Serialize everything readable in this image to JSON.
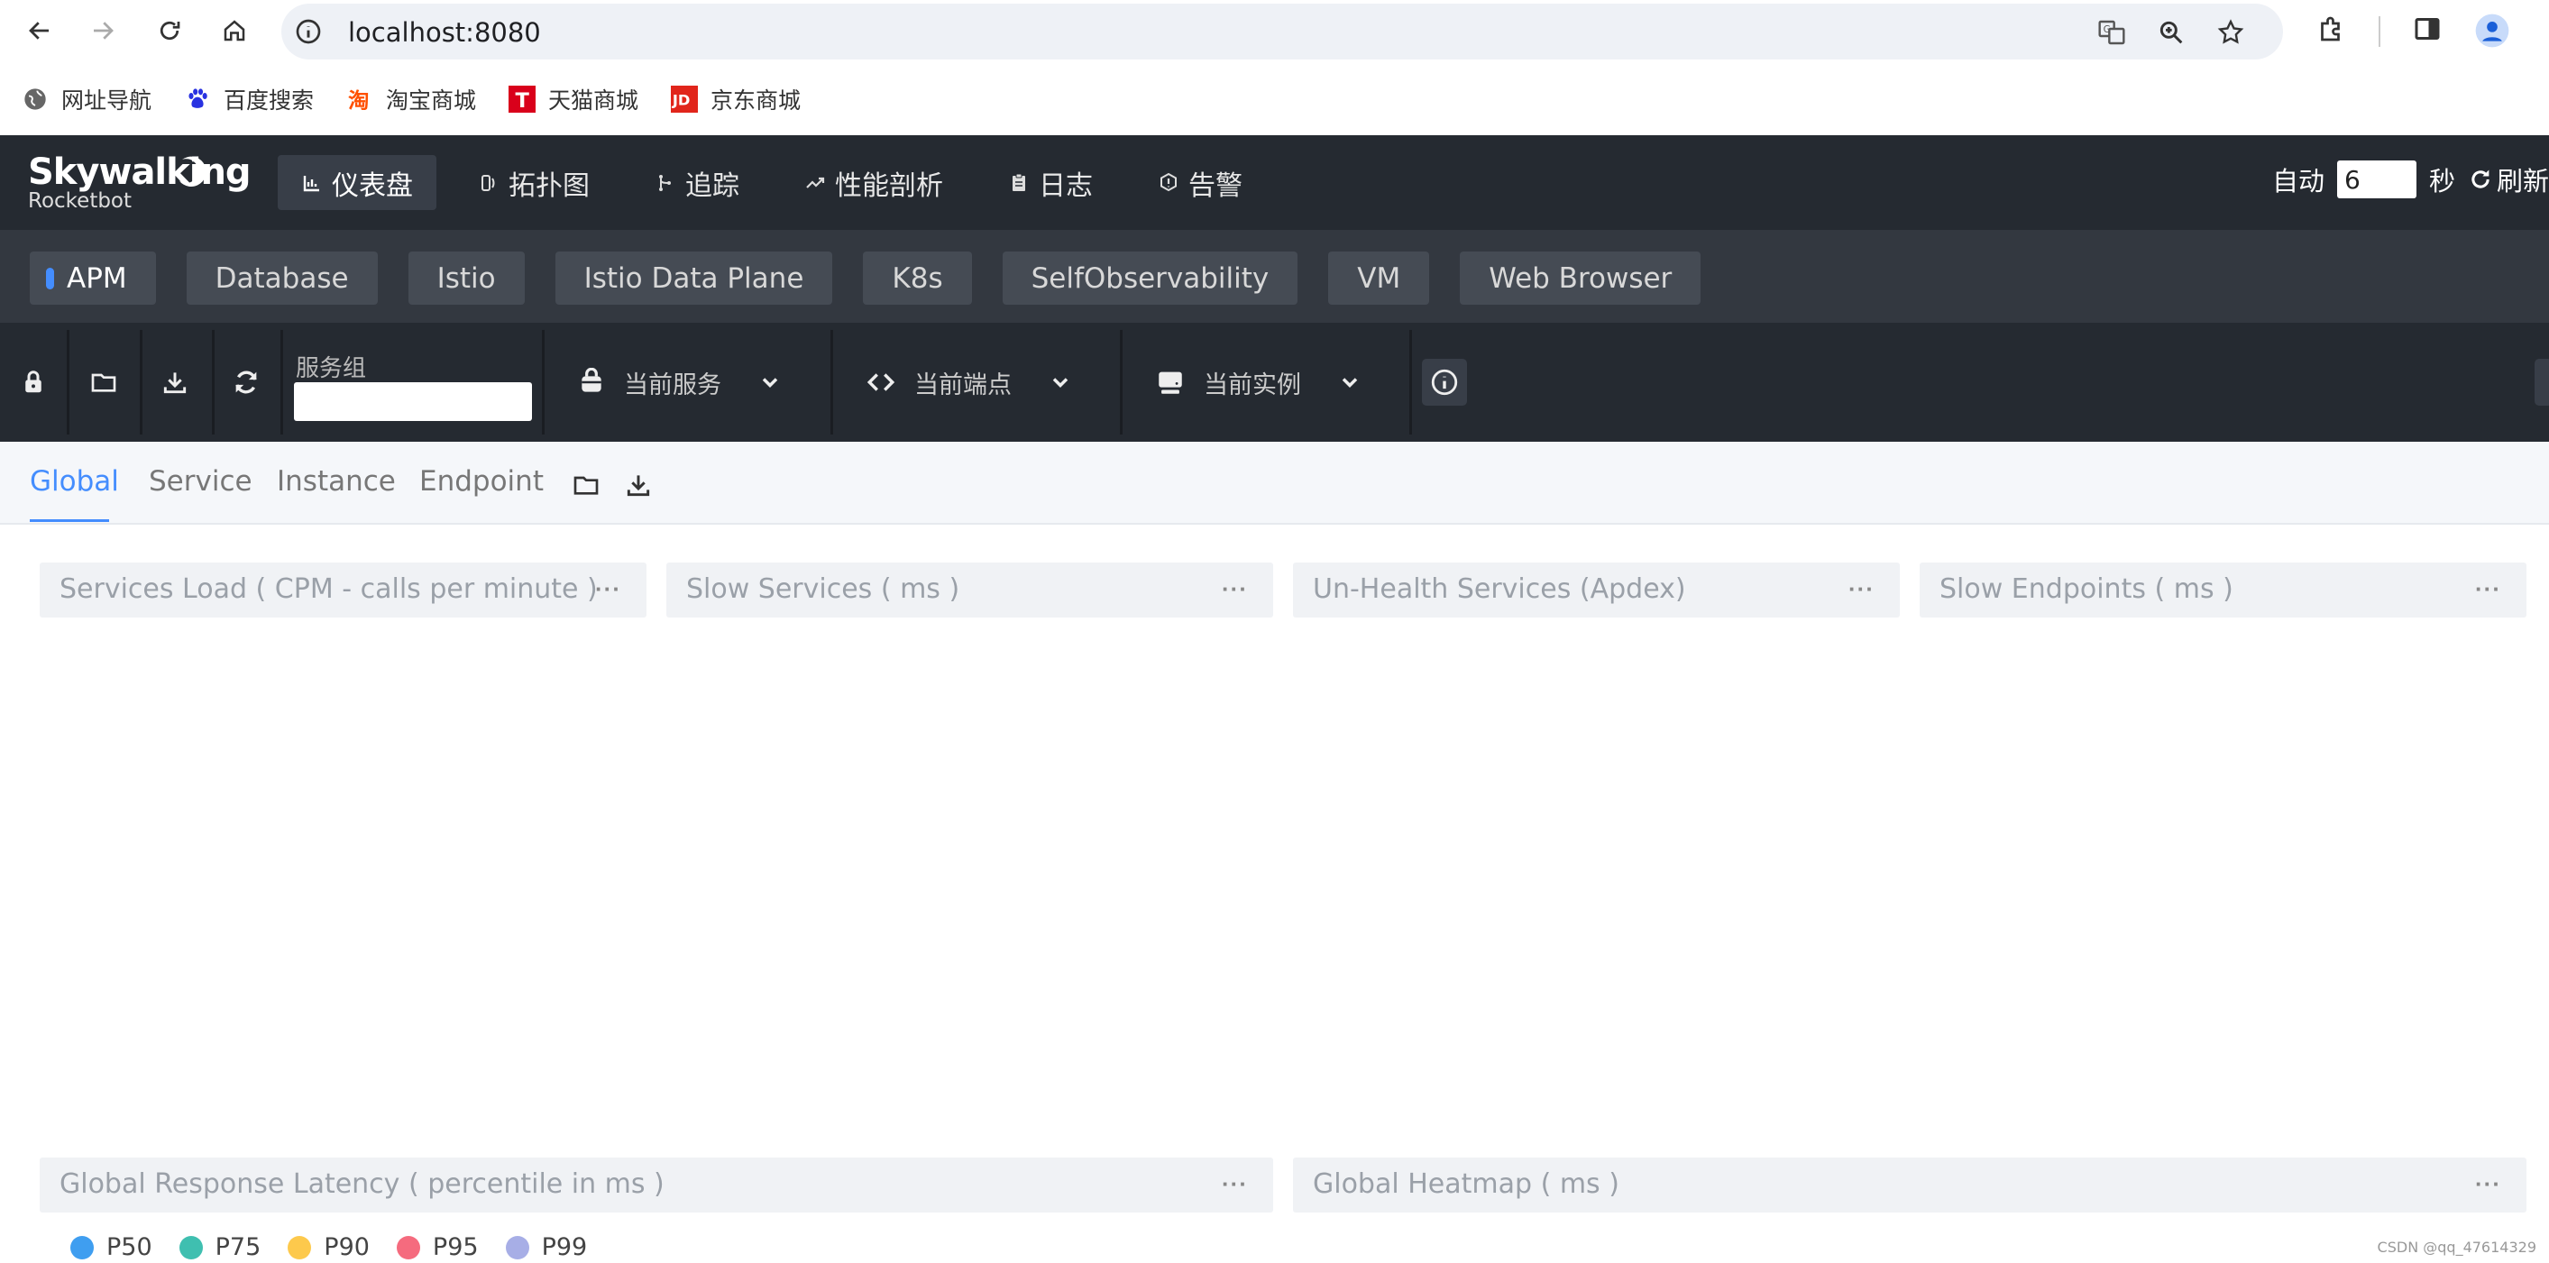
{
  "browser": {
    "url": "localhost:8080",
    "bookmarks": [
      {
        "label": "网址导航",
        "icon": "globe-icon"
      },
      {
        "label": "百度搜索",
        "icon": "baidu-paw-icon"
      },
      {
        "label": "淘宝商城",
        "icon": "taobao-icon"
      },
      {
        "label": "天猫商城",
        "icon": "tmall-icon"
      },
      {
        "label": "京东商城",
        "icon": "jd-icon"
      }
    ]
  },
  "header": {
    "logo_title": "Skywalking",
    "logo_subtitle": "Rocketbot",
    "nav": [
      {
        "label": "仪表盘",
        "icon": "dashboard-icon",
        "active": true
      },
      {
        "label": "拓扑图",
        "icon": "topology-icon",
        "active": false
      },
      {
        "label": "追踪",
        "icon": "trace-icon",
        "active": false
      },
      {
        "label": "性能剖析",
        "icon": "profile-icon",
        "active": false
      },
      {
        "label": "日志",
        "icon": "log-icon",
        "active": false
      },
      {
        "label": "告警",
        "icon": "alarm-icon",
        "active": false
      }
    ],
    "auto_label": "自动",
    "interval_value": "6",
    "seconds_label": "秒",
    "refresh_label": "刷新"
  },
  "templates": {
    "tabs": [
      "APM",
      "Database",
      "Istio",
      "Istio Data Plane",
      "K8s",
      "SelfObservability",
      "VM",
      "Web Browser"
    ],
    "active": "APM"
  },
  "toolbar": {
    "service_group_label": "服务组",
    "service_group_value": "",
    "current_service": "当前服务",
    "current_endpoint": "当前端点",
    "current_instance": "当前实例"
  },
  "dashboard_tabs": {
    "tabs": [
      "Global",
      "Service",
      "Instance",
      "Endpoint"
    ],
    "active": "Global"
  },
  "panels": {
    "services_load": "Services Load ( CPM - calls per minute )",
    "slow_services": "Slow Services ( ms )",
    "unhealth_services": "Un-Health Services (Apdex)",
    "slow_endpoints": "Slow Endpoints ( ms )",
    "global_latency": "Global Response Latency ( percentile in ms )",
    "global_heatmap": "Global Heatmap ( ms )",
    "more_glyph": "···"
  },
  "latency_legend": [
    {
      "label": "P50",
      "color": "#3f9ef0"
    },
    {
      "label": "P75",
      "color": "#3fbfb0"
    },
    {
      "label": "P90",
      "color": "#fdc94c"
    },
    {
      "label": "P95",
      "color": "#f56b7e"
    },
    {
      "label": "P99",
      "color": "#a7aee6"
    }
  ],
  "watermark": "CSDN @qq_47614329",
  "colors": {
    "header_bg": "#252a31",
    "template_bar_bg": "#333840",
    "accent": "#448dfe"
  }
}
